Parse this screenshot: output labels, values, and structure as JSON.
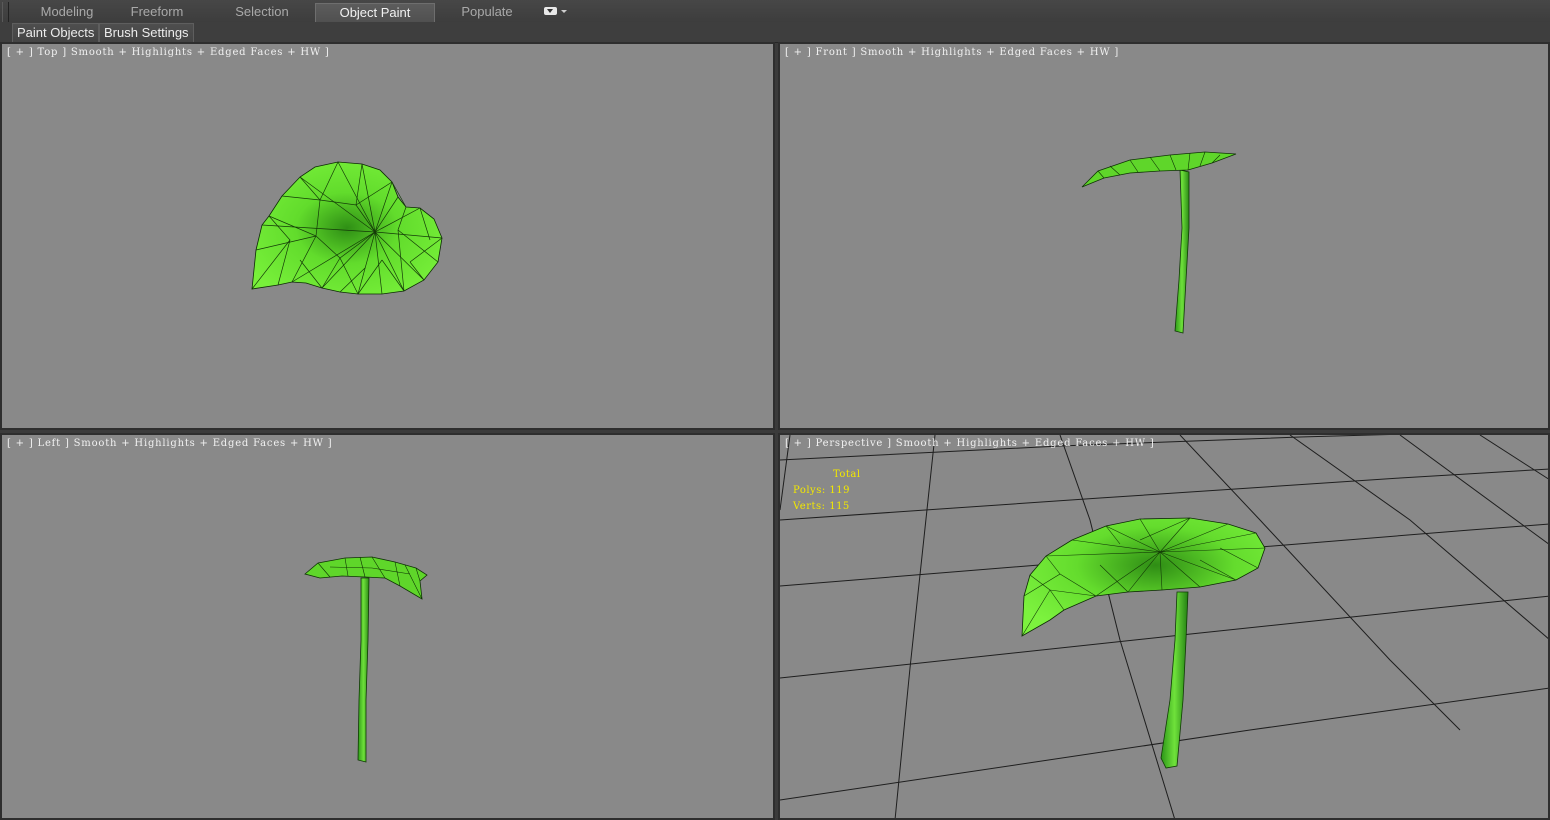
{
  "ribbon": {
    "tabs": [
      {
        "label": "Modeling",
        "active": false
      },
      {
        "label": "Freeform",
        "active": false
      },
      {
        "label": "Selection",
        "active": false
      },
      {
        "label": "Object Paint",
        "active": true
      },
      {
        "label": "Populate",
        "active": false
      }
    ],
    "dropdown_icon": "ribbon-menu-icon"
  },
  "panels": {
    "paint_objects": "Paint Objects",
    "brush_settings": "Brush Settings"
  },
  "viewports": {
    "top": {
      "label": "[ + ] Top ] Smooth + Highlights + Edged Faces + HW ]"
    },
    "front": {
      "label": "[ + ] Front ] Smooth + Highlights + Edged Faces + HW ]"
    },
    "left": {
      "label": "[ + ] Left ] Smooth + Highlights + Edged Faces + HW ]"
    },
    "perspective": {
      "label": "[ + ] Perspective ] Smooth + Highlights + Edged Faces + HW ]",
      "stats": {
        "title": "Total",
        "polys": "Polys: 119",
        "verts": "Verts: 115"
      }
    }
  },
  "colors": {
    "viewport_bg": "#898989",
    "leaf_green": "#5ed62a",
    "stats_yellow": "#f2e800"
  }
}
